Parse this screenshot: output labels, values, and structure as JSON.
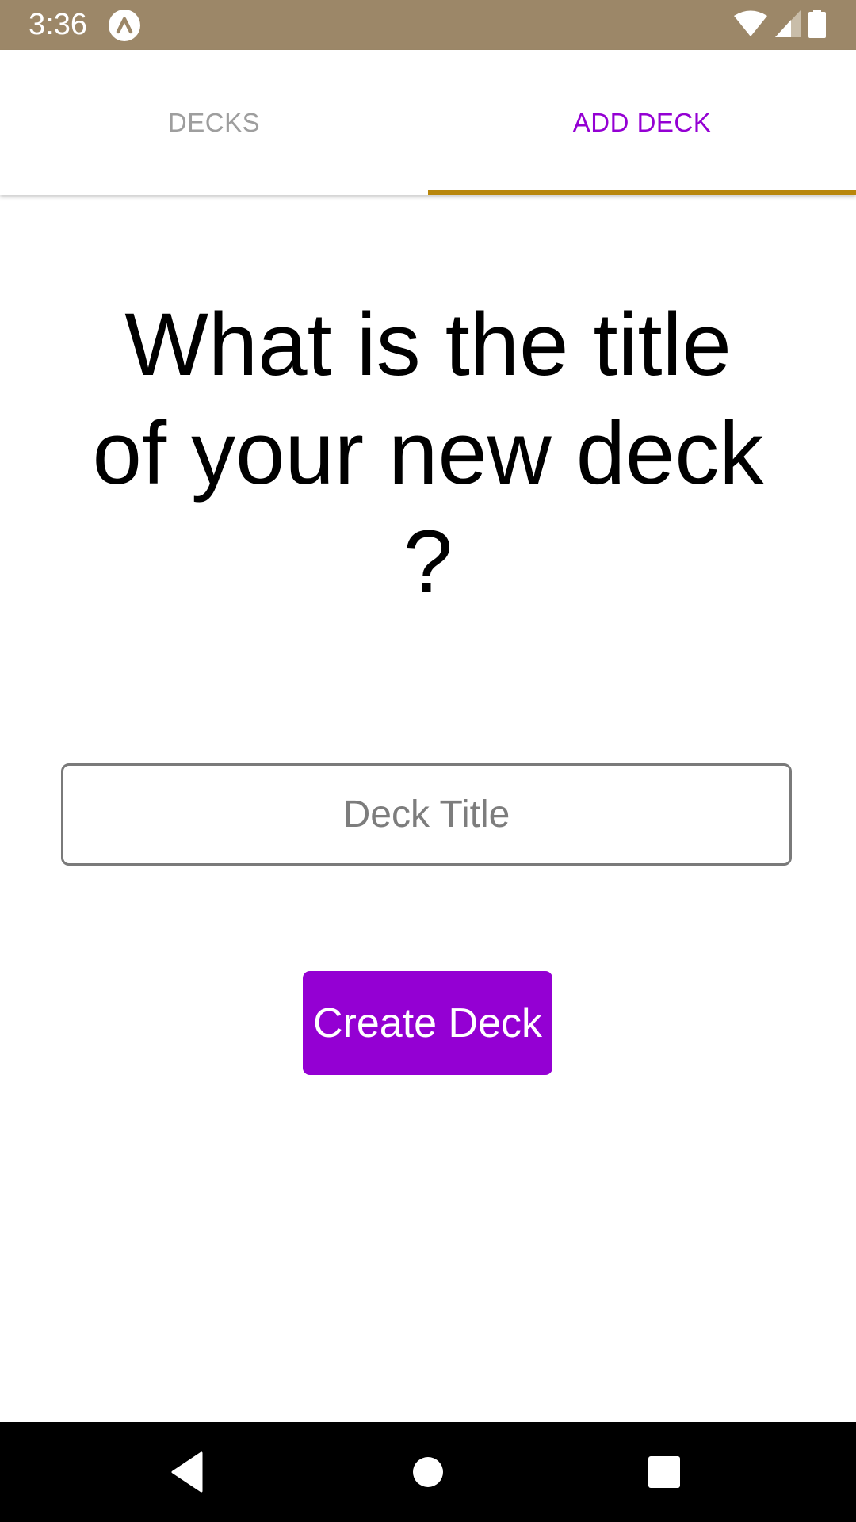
{
  "status_bar": {
    "time": "3:36",
    "icons": [
      "app-notification-icon",
      "wifi-icon",
      "cell-signal-icon",
      "battery-icon"
    ],
    "background_color": "#9c8768"
  },
  "tabs": [
    {
      "label": "DECKS",
      "selected": false
    },
    {
      "label": "ADD DECK",
      "selected": true
    }
  ],
  "colors": {
    "accent": "#9400d3",
    "tab_indicator": "#b8860b",
    "inactive_tab": "#9e9e9e"
  },
  "main": {
    "question": "What is the title of your new deck ?",
    "title_input": {
      "value": "",
      "placeholder": "Deck Title"
    },
    "create_button_label": "Create Deck"
  },
  "nav_bar": {
    "buttons": [
      "back-icon",
      "home-icon",
      "recents-icon"
    ]
  }
}
